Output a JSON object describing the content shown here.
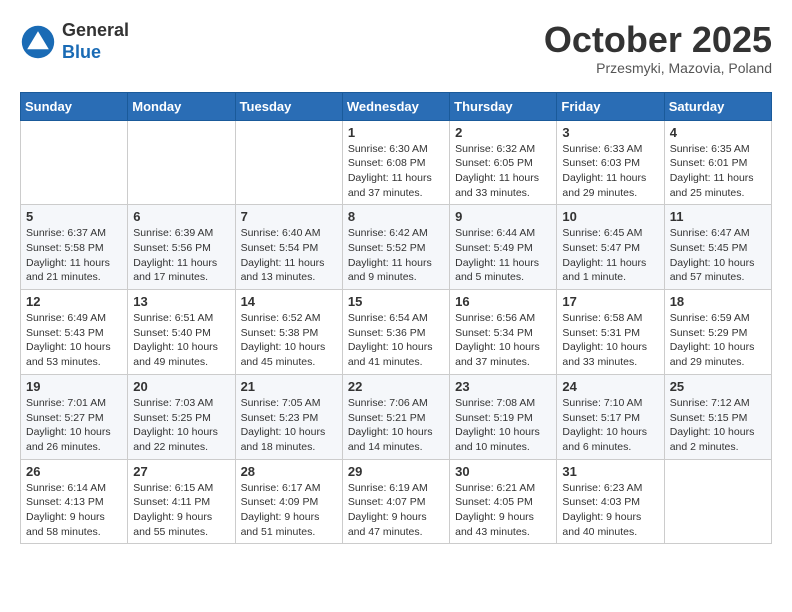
{
  "logo": {
    "general": "General",
    "blue": "Blue"
  },
  "header": {
    "month": "October 2025",
    "location": "Przesmyki, Mazovia, Poland"
  },
  "days_of_week": [
    "Sunday",
    "Monday",
    "Tuesday",
    "Wednesday",
    "Thursday",
    "Friday",
    "Saturday"
  ],
  "weeks": [
    [
      {
        "day": "",
        "info": ""
      },
      {
        "day": "",
        "info": ""
      },
      {
        "day": "",
        "info": ""
      },
      {
        "day": "1",
        "info": "Sunrise: 6:30 AM\nSunset: 6:08 PM\nDaylight: 11 hours\nand 37 minutes."
      },
      {
        "day": "2",
        "info": "Sunrise: 6:32 AM\nSunset: 6:05 PM\nDaylight: 11 hours\nand 33 minutes."
      },
      {
        "day": "3",
        "info": "Sunrise: 6:33 AM\nSunset: 6:03 PM\nDaylight: 11 hours\nand 29 minutes."
      },
      {
        "day": "4",
        "info": "Sunrise: 6:35 AM\nSunset: 6:01 PM\nDaylight: 11 hours\nand 25 minutes."
      }
    ],
    [
      {
        "day": "5",
        "info": "Sunrise: 6:37 AM\nSunset: 5:58 PM\nDaylight: 11 hours\nand 21 minutes."
      },
      {
        "day": "6",
        "info": "Sunrise: 6:39 AM\nSunset: 5:56 PM\nDaylight: 11 hours\nand 17 minutes."
      },
      {
        "day": "7",
        "info": "Sunrise: 6:40 AM\nSunset: 5:54 PM\nDaylight: 11 hours\nand 13 minutes."
      },
      {
        "day": "8",
        "info": "Sunrise: 6:42 AM\nSunset: 5:52 PM\nDaylight: 11 hours\nand 9 minutes."
      },
      {
        "day": "9",
        "info": "Sunrise: 6:44 AM\nSunset: 5:49 PM\nDaylight: 11 hours\nand 5 minutes."
      },
      {
        "day": "10",
        "info": "Sunrise: 6:45 AM\nSunset: 5:47 PM\nDaylight: 11 hours\nand 1 minute."
      },
      {
        "day": "11",
        "info": "Sunrise: 6:47 AM\nSunset: 5:45 PM\nDaylight: 10 hours\nand 57 minutes."
      }
    ],
    [
      {
        "day": "12",
        "info": "Sunrise: 6:49 AM\nSunset: 5:43 PM\nDaylight: 10 hours\nand 53 minutes."
      },
      {
        "day": "13",
        "info": "Sunrise: 6:51 AM\nSunset: 5:40 PM\nDaylight: 10 hours\nand 49 minutes."
      },
      {
        "day": "14",
        "info": "Sunrise: 6:52 AM\nSunset: 5:38 PM\nDaylight: 10 hours\nand 45 minutes."
      },
      {
        "day": "15",
        "info": "Sunrise: 6:54 AM\nSunset: 5:36 PM\nDaylight: 10 hours\nand 41 minutes."
      },
      {
        "day": "16",
        "info": "Sunrise: 6:56 AM\nSunset: 5:34 PM\nDaylight: 10 hours\nand 37 minutes."
      },
      {
        "day": "17",
        "info": "Sunrise: 6:58 AM\nSunset: 5:31 PM\nDaylight: 10 hours\nand 33 minutes."
      },
      {
        "day": "18",
        "info": "Sunrise: 6:59 AM\nSunset: 5:29 PM\nDaylight: 10 hours\nand 29 minutes."
      }
    ],
    [
      {
        "day": "19",
        "info": "Sunrise: 7:01 AM\nSunset: 5:27 PM\nDaylight: 10 hours\nand 26 minutes."
      },
      {
        "day": "20",
        "info": "Sunrise: 7:03 AM\nSunset: 5:25 PM\nDaylight: 10 hours\nand 22 minutes."
      },
      {
        "day": "21",
        "info": "Sunrise: 7:05 AM\nSunset: 5:23 PM\nDaylight: 10 hours\nand 18 minutes."
      },
      {
        "day": "22",
        "info": "Sunrise: 7:06 AM\nSunset: 5:21 PM\nDaylight: 10 hours\nand 14 minutes."
      },
      {
        "day": "23",
        "info": "Sunrise: 7:08 AM\nSunset: 5:19 PM\nDaylight: 10 hours\nand 10 minutes."
      },
      {
        "day": "24",
        "info": "Sunrise: 7:10 AM\nSunset: 5:17 PM\nDaylight: 10 hours\nand 6 minutes."
      },
      {
        "day": "25",
        "info": "Sunrise: 7:12 AM\nSunset: 5:15 PM\nDaylight: 10 hours\nand 2 minutes."
      }
    ],
    [
      {
        "day": "26",
        "info": "Sunrise: 6:14 AM\nSunset: 4:13 PM\nDaylight: 9 hours\nand 58 minutes."
      },
      {
        "day": "27",
        "info": "Sunrise: 6:15 AM\nSunset: 4:11 PM\nDaylight: 9 hours\nand 55 minutes."
      },
      {
        "day": "28",
        "info": "Sunrise: 6:17 AM\nSunset: 4:09 PM\nDaylight: 9 hours\nand 51 minutes."
      },
      {
        "day": "29",
        "info": "Sunrise: 6:19 AM\nSunset: 4:07 PM\nDaylight: 9 hours\nand 47 minutes."
      },
      {
        "day": "30",
        "info": "Sunrise: 6:21 AM\nSunset: 4:05 PM\nDaylight: 9 hours\nand 43 minutes."
      },
      {
        "day": "31",
        "info": "Sunrise: 6:23 AM\nSunset: 4:03 PM\nDaylight: 9 hours\nand 40 minutes."
      },
      {
        "day": "",
        "info": ""
      }
    ]
  ]
}
